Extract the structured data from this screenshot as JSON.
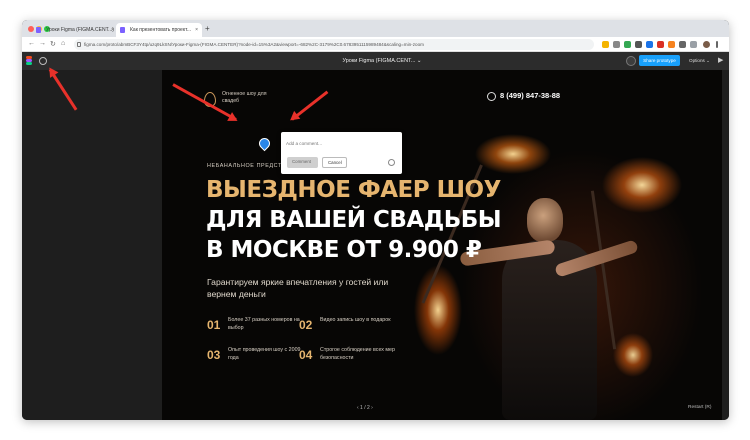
{
  "browser": {
    "tabs": [
      {
        "title": "Уроки Figma (FIGMA.CENT...)",
        "active": false
      },
      {
        "title": "Как презентовать проект...",
        "active": true
      }
    ],
    "new_tab": "+",
    "close_glyph": "×",
    "url": "figma.com/proto/abmBCF3Y4tp/uzq9LkSN/Уроки-Figma-(FIGMA.CENTER)?node-id=15%3A2&viewport=-682%2C-3179%2C0.6783951115989484&scaling=min-zoom",
    "nav": {
      "back": "←",
      "forward": "→",
      "reload": "↻",
      "home": "⌂"
    }
  },
  "figma": {
    "file_title": "Уроки Figma (FIGMA.CENT...",
    "dropdown": "⌄",
    "share_label": "Share prototype",
    "options_label": "Options ⌄",
    "play_icon": "▶"
  },
  "site": {
    "brand": "Огненное шоу для свадеб",
    "phone": "8 (499) 847-38-88",
    "eyebrow": "НЕБАНАЛЬНОЕ ПРЕДСТ...",
    "headline": [
      "ВЫЕЗДНОЕ ФАЕР ШОУ",
      "ДЛЯ ВАШЕЙ СВАДЬБЫ",
      "В МОСКВЕ ОТ 9.900 ₽"
    ],
    "subtitle": "Гарантируем яркие впечатления у гостей или вернем деньги",
    "features": [
      {
        "num": "01",
        "text": "Более 37 разных номеров на выбор"
      },
      {
        "num": "02",
        "text": "Видео запись шоу в подарок"
      },
      {
        "num": "03",
        "text": "Опыт проведения шоу с 2009 года"
      },
      {
        "num": "04",
        "text": "Строгое соблюдение всех мер безопасности"
      }
    ]
  },
  "prototype_footer": {
    "pager": "‹   1 / 2   ›",
    "restart": "Restart (R)"
  },
  "comment": {
    "placeholder": "Add a comment...",
    "post_label": "Comment",
    "cancel_label": "Cancel"
  },
  "colors": {
    "accent_gold": "#e6b56f",
    "share_blue": "#18a0fb",
    "pin_blue": "#2a86e8",
    "arrow_red": "#e8312a"
  }
}
